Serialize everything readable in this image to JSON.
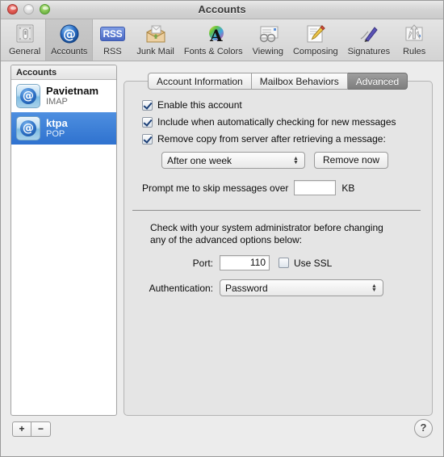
{
  "window": {
    "title": "Accounts",
    "traffic": {
      "close": "close-button",
      "minimize": "minimize-button",
      "zoom": "zoom-button"
    }
  },
  "toolbar": {
    "items": [
      {
        "label": "General",
        "icon": "general-icon"
      },
      {
        "label": "Accounts",
        "icon": "accounts-at-icon",
        "selected": true
      },
      {
        "label": "RSS",
        "icon": "rss-badge-icon"
      },
      {
        "label": "Junk Mail",
        "icon": "junk-mail-icon"
      },
      {
        "label": "Fonts & Colors",
        "icon": "fonts-colors-icon"
      },
      {
        "label": "Viewing",
        "icon": "viewing-icon"
      },
      {
        "label": "Composing",
        "icon": "composing-icon"
      },
      {
        "label": "Signatures",
        "icon": "signatures-icon"
      },
      {
        "label": "Rules",
        "icon": "rules-icon"
      }
    ]
  },
  "sidebar": {
    "header": "Accounts",
    "accounts": [
      {
        "name": "Pavietnam",
        "type": "IMAP",
        "selected": false
      },
      {
        "name": "ktpa",
        "type": "POP",
        "selected": true
      }
    ],
    "add_label": "+",
    "remove_label": "−"
  },
  "tabs": [
    {
      "label": "Account Information",
      "active": false
    },
    {
      "label": "Mailbox Behaviors",
      "active": false
    },
    {
      "label": "Advanced",
      "active": true
    }
  ],
  "advanced": {
    "checkboxes": [
      {
        "label": "Enable this account",
        "checked": true
      },
      {
        "label": "Include when automatically checking for new messages",
        "checked": true
      },
      {
        "label": "Remove copy from server after retrieving a message:",
        "checked": true
      }
    ],
    "remove_schedule": "After one week",
    "remove_now_label": "Remove now",
    "skip_prefix": "Prompt me to skip messages over",
    "skip_value": "",
    "skip_suffix": "KB",
    "admin_note_line1": "Check with your system administrator before changing",
    "admin_note_line2": "any of the advanced options below:",
    "port_label": "Port:",
    "port_value": "110",
    "use_ssl_label": "Use SSL",
    "use_ssl_checked": false,
    "auth_label": "Authentication:",
    "auth_value": "Password"
  },
  "help_label": "?",
  "colors": {
    "selection_blue": "#2f72cf",
    "active_tab_gray": "#8a8a8a",
    "window_bg": "#ececec"
  }
}
